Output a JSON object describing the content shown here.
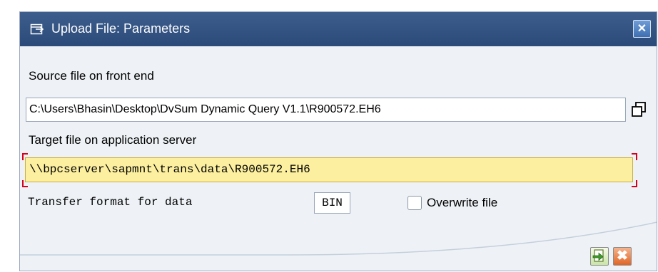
{
  "dialog": {
    "title": "Upload File: Parameters",
    "close_symbol": "✕",
    "title_icon": "window-icon",
    "close_icon": "close-icon"
  },
  "source": {
    "label": "Source file on front end",
    "value": "C:\\Users\\Bhasin\\Desktop\\DvSum Dynamic Query V1.1\\R900572.EH6",
    "help_icon": "copy-value-icon"
  },
  "target": {
    "label": "Target file on application server",
    "value": "\\\\bpcserver\\sapmnt\\trans\\data\\R900572.EH6"
  },
  "format": {
    "label": "Transfer format for data",
    "value": "BIN"
  },
  "overwrite": {
    "label": "Overwrite file",
    "checked": false
  },
  "footer": {
    "ok_icon": "continue-icon",
    "cancel_icon": "cancel-icon",
    "cancel_symbol": "✖"
  },
  "colors": {
    "titlebar": "#2f4f7f",
    "target_field_bg": "#fcef9f",
    "required_marker": "#d9001b",
    "dialog_bg": "#eef2f6"
  }
}
